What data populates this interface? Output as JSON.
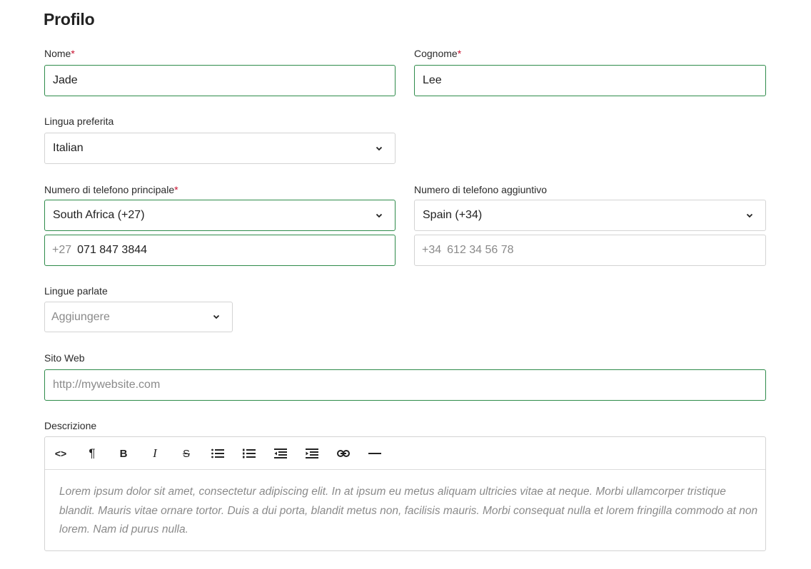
{
  "page": {
    "title": "Profilo"
  },
  "colors": {
    "focus_border": "#2e8b4a",
    "required": "#c8102e",
    "border": "#d3d3d3"
  },
  "fields": {
    "first_name": {
      "label": "Nome",
      "required_mark": "*",
      "value": "Jade"
    },
    "last_name": {
      "label": "Cognome",
      "required_mark": "*",
      "value": "Lee"
    },
    "language": {
      "label": "Lingua preferita",
      "value": "Italian"
    },
    "phone_primary": {
      "label": "Numero di telefono principale",
      "required_mark": "*",
      "country": "South Africa (+27)",
      "prefix": "+27",
      "value": "071 847 3844"
    },
    "phone_additional": {
      "label": "Numero di telefono aggiuntivo",
      "country": "Spain (+34)",
      "prefix": "+34",
      "placeholder": "612 34 56 78"
    },
    "spoken_languages": {
      "label": "Lingue parlate",
      "placeholder": "Aggiungere"
    },
    "website": {
      "label": "Sito Web",
      "placeholder": "http://mywebsite.com"
    },
    "description": {
      "label": "Descrizione",
      "placeholder": "Lorem ipsum dolor sit amet, consectetur adipiscing elit. In at ipsum eu metus aliquam ultricies vitae at neque. Morbi ullamcorper tristique blandit. Mauris vitae ornare tortor. Duis a dui porta, blandit metus non, facilisis mauris. Morbi consequat nulla et lorem fringilla commodo at non lorem. Nam id purus nulla."
    }
  },
  "toolbar": {
    "icons": [
      "code-icon",
      "paragraph-icon",
      "bold-icon",
      "italic-icon",
      "strikethrough-icon",
      "bullet-list-icon",
      "ordered-list-icon",
      "outdent-icon",
      "indent-icon",
      "link-icon",
      "horizontal-rule-icon"
    ],
    "code": "<>",
    "paragraph": "¶",
    "bold": "B",
    "italic": "I",
    "strike": "S"
  }
}
